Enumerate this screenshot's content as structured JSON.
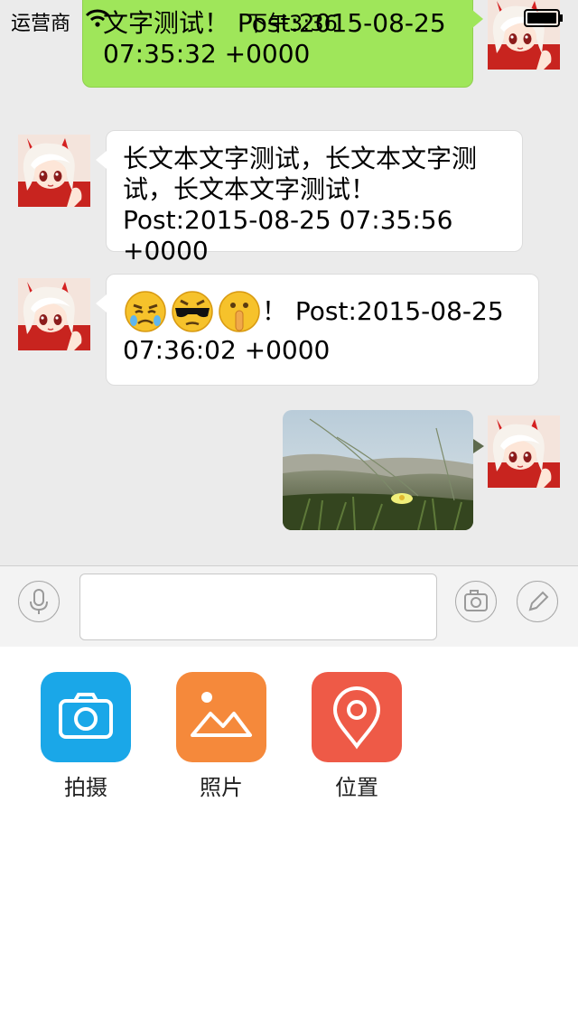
{
  "status_bar": {
    "carrier": "运营商",
    "time": "下午3:36"
  },
  "messages": [
    {
      "direction": "out",
      "type": "text",
      "text": "文字测试！ Post:2015-08-25 07:35:32 +0000"
    },
    {
      "direction": "in",
      "type": "text",
      "text": "长文本文字测试，长文本文字测试，长文本文字测试！Post:2015-08-25 07:35:56 +0000"
    },
    {
      "direction": "in",
      "type": "emoji-text",
      "emojis": [
        "crying-face",
        "cool-face",
        "shush-face"
      ],
      "text": "！ Post:2015-08-25 07:36:02 +0000"
    },
    {
      "direction": "out",
      "type": "image",
      "image": "photo-beach-grass-flower"
    }
  ],
  "input_bar": {
    "voice_icon": "microphone-icon",
    "text_value": "",
    "camera_icon": "camera-icon",
    "edit_icon": "pencil-icon"
  },
  "tools": [
    {
      "label": "拍摄",
      "icon": "camera-icon",
      "color": "#1aa7e8"
    },
    {
      "label": "照片",
      "icon": "photo-icon",
      "color": "#f5893b"
    },
    {
      "label": "位置",
      "icon": "location-icon",
      "color": "#ee5a47"
    }
  ]
}
